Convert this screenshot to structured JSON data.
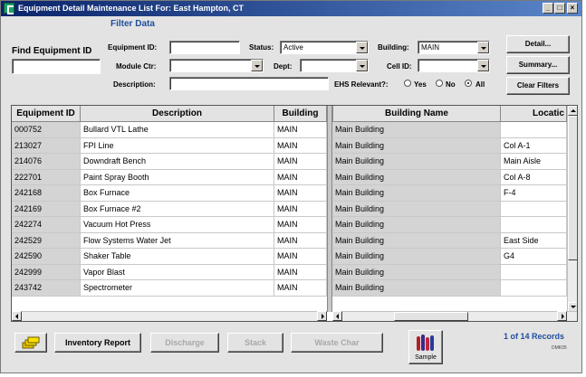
{
  "window": {
    "title": "Equipment Detail Maintenance List For: East Hampton, CT",
    "controls": [
      "_",
      "□",
      "×"
    ]
  },
  "find": {
    "label": "Find Equipment ID",
    "value": ""
  },
  "filter": {
    "title": "Filter Data",
    "equipment_id": {
      "label": "Equipment ID:",
      "value": ""
    },
    "status": {
      "label": "Status:",
      "value": "Active"
    },
    "building": {
      "label": "Building:",
      "value": "MAIN"
    },
    "module_ctr": {
      "label": "Module Ctr:",
      "value": ""
    },
    "dept": {
      "label": "Dept:",
      "value": ""
    },
    "cell_id": {
      "label": "Cell ID:",
      "value": ""
    },
    "description": {
      "label": "Description:",
      "value": ""
    },
    "ehs": {
      "label": "EHS Relevant?:",
      "options": [
        "Yes",
        "No",
        "All"
      ],
      "selected": "All"
    }
  },
  "side_buttons": {
    "detail": "Detail...",
    "summary": "Summary...",
    "clear_filters": "Clear Filters"
  },
  "grid": {
    "left_columns": [
      "Equipment ID",
      "Description",
      "Building"
    ],
    "right_columns": [
      "Building Name",
      "Locatic"
    ],
    "rows": [
      {
        "id": "000752",
        "desc": "Bullard VTL Lathe",
        "bldg": "MAIN",
        "bname": "Main Building",
        "loc": ""
      },
      {
        "id": "213027",
        "desc": "FPI Line",
        "bldg": "MAIN",
        "bname": "Main Building",
        "loc": "Col A-1"
      },
      {
        "id": "214076",
        "desc": "Downdraft Bench",
        "bldg": "MAIN",
        "bname": "Main Building",
        "loc": "Main Aisle"
      },
      {
        "id": "222701",
        "desc": "Paint Spray Booth",
        "bldg": "MAIN",
        "bname": "Main Building",
        "loc": "Col A-8"
      },
      {
        "id": "242168",
        "desc": "Box Furnace",
        "bldg": "MAIN",
        "bname": "Main Building",
        "loc": "F-4"
      },
      {
        "id": "242169",
        "desc": "Box Furnace #2",
        "bldg": "MAIN",
        "bname": "Main Building",
        "loc": ""
      },
      {
        "id": "242274",
        "desc": "Vacuum Hot Press",
        "bldg": "MAIN",
        "bname": "Main Building",
        "loc": ""
      },
      {
        "id": "242529",
        "desc": "Flow Systems Water Jet",
        "bldg": "MAIN",
        "bname": "Main Building",
        "loc": "East Side"
      },
      {
        "id": "242590",
        "desc": "Shaker Table",
        "bldg": "MAIN",
        "bname": "Main Building",
        "loc": "G4"
      },
      {
        "id": "242999",
        "desc": "Vapor Blast",
        "bldg": "MAIN",
        "bname": "Main Building",
        "loc": ""
      },
      {
        "id": "243742",
        "desc": "Spectrometer",
        "bldg": "MAIN",
        "bname": "Main Building",
        "loc": ""
      }
    ]
  },
  "footer": {
    "inventory_report": "Inventory Report",
    "discharge": "Discharge",
    "stack": "Stack",
    "waste_char": "Waste Char",
    "sample": "Sample",
    "record_count": "1 of 14 Records",
    "form_code": "DMK05"
  },
  "colors": {
    "title_start": "#0a246a",
    "title_end": "#5a86c8",
    "group_title": "#1f4e9e",
    "record_text": "#1f4e9e"
  }
}
